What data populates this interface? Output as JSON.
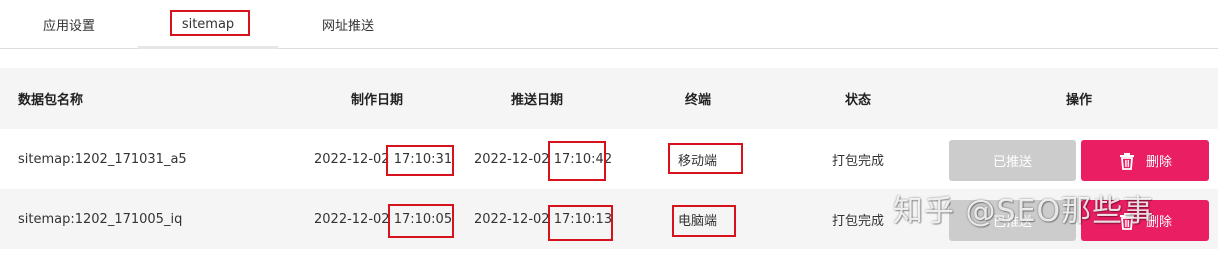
{
  "tabs": [
    {
      "label": "应用设置"
    },
    {
      "label": "sitemap",
      "active": true
    },
    {
      "label": "网址推送"
    }
  ],
  "table": {
    "headers": {
      "name": "数据包名称",
      "created": "制作日期",
      "pushed": "推送日期",
      "terminal": "终端",
      "status": "状态",
      "ops": "操作"
    },
    "rows": [
      {
        "name": "sitemap:1202_171031_a5",
        "created_date": "2022-12-02",
        "created_time": "17:10:31",
        "pushed_date": "2022-12-02",
        "pushed_time": "17:10:42",
        "terminal": "移动端",
        "status": "打包完成",
        "push_label": "已推送",
        "delete_label": "删除"
      },
      {
        "name": "sitemap:1202_171005_iq",
        "created_date": "2022-12-02",
        "created_time": "17:10:05",
        "pushed_date": "2022-12-02",
        "pushed_time": "17:10:13",
        "terminal": "电脑端",
        "status": "打包完成",
        "push_label": "已推送",
        "delete_label": "删除"
      }
    ]
  },
  "watermark": "知乎 @SEO那些事",
  "colors": {
    "delete_button": "#e91e63",
    "pushed_button": "#cccccc",
    "highlight_box": "#d6121c",
    "header_bg": "#f5f5f5"
  },
  "icons": {
    "delete": "trash-icon"
  }
}
